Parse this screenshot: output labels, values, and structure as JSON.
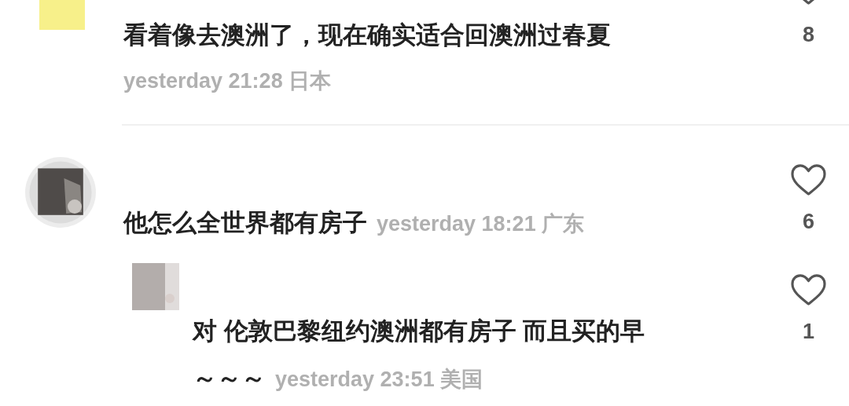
{
  "comments": [
    {
      "text": "看着像去澳洲了，现在确实适合回澳洲过春夏",
      "time": "yesterday 21:28",
      "region": "日本",
      "likes": "8",
      "meta_inline": false
    },
    {
      "text": "他怎么全世界都有房子",
      "time": "yesterday 18:21",
      "region": "广东",
      "likes": "6",
      "meta_inline": true,
      "replies": [
        {
          "text_lines": [
            "对 伦敦巴黎纽约澳洲都有房子 而且买的早",
            "～～～"
          ],
          "time": "yesterday 23:51",
          "region": "美国",
          "likes": "1",
          "meta_inline": true
        }
      ]
    }
  ]
}
